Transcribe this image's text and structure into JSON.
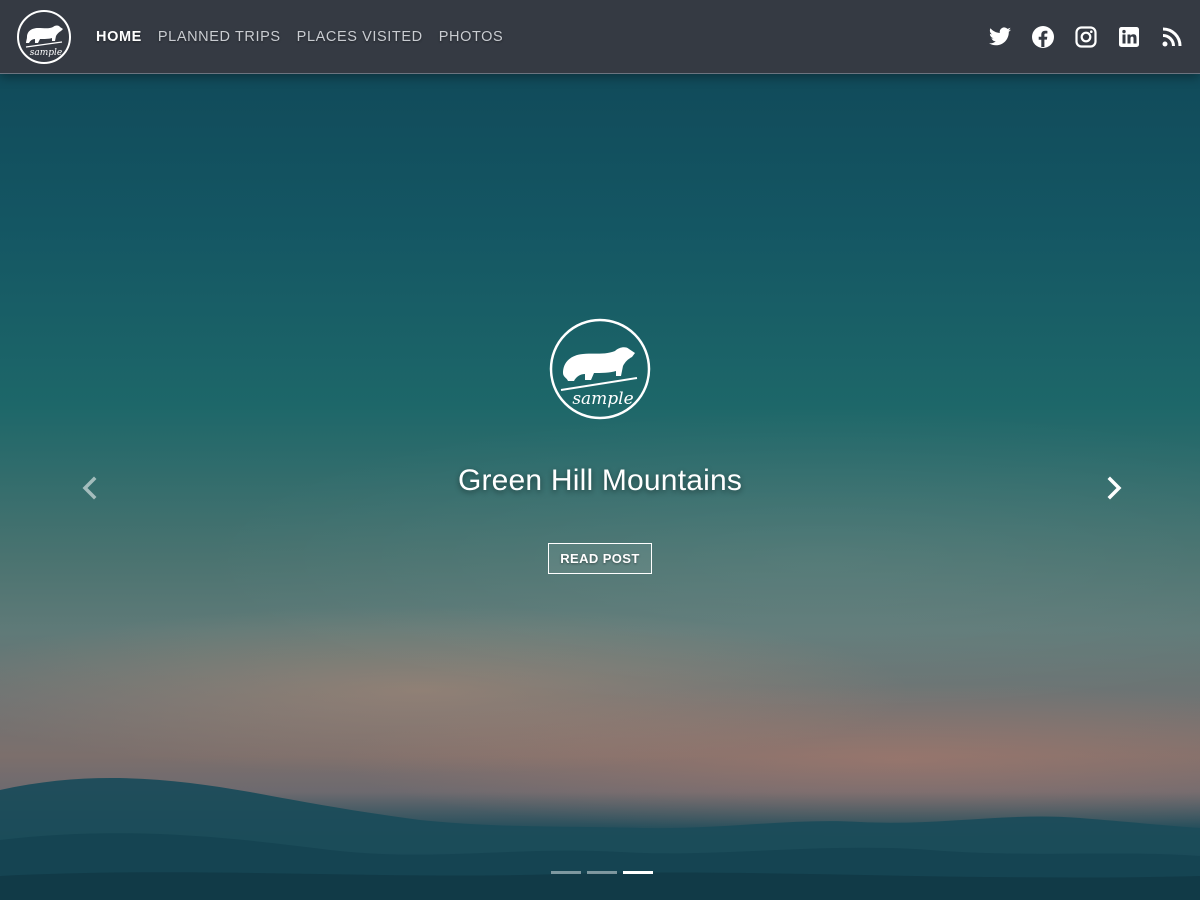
{
  "nav": {
    "logo_alt": "sample",
    "links": [
      {
        "label": "HOME",
        "active": true
      },
      {
        "label": "PLANNED TRIPS",
        "active": false
      },
      {
        "label": "PLACES VISITED",
        "active": false
      },
      {
        "label": "PHOTOS",
        "active": false
      }
    ],
    "social": [
      {
        "name": "twitter-icon"
      },
      {
        "name": "facebook-icon"
      },
      {
        "name": "instagram-icon"
      },
      {
        "name": "linkedin-icon"
      },
      {
        "name": "rss-icon"
      }
    ]
  },
  "slide": {
    "logo_text": "sample",
    "title": "Green Hill Mountains",
    "button_label": "READ POST"
  },
  "carousel": {
    "slide_count": 3,
    "active_index": 2
  },
  "colors": {
    "navbar_bg": "#353a43",
    "accent": "#ffffff",
    "sky_top": "#0f4556"
  }
}
